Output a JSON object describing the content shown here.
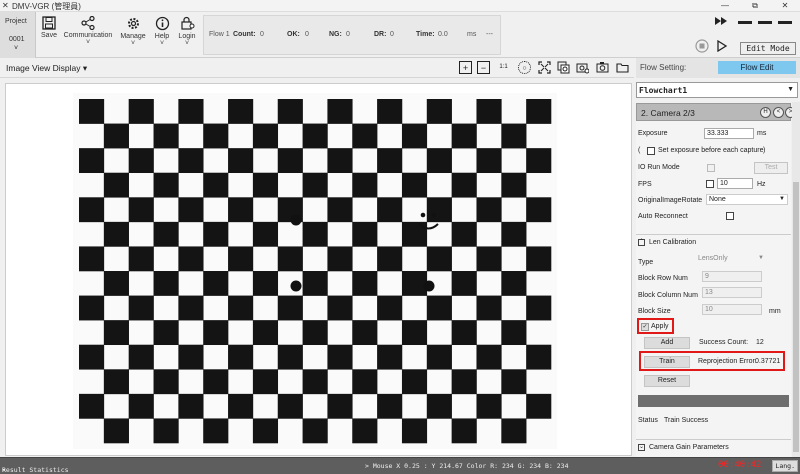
{
  "app": {
    "logo": "✕",
    "title": "DMV-VGR (管理員)",
    "min": "—",
    "restore": "⧉",
    "close": "✕"
  },
  "toolbar": {
    "project_label": "Project",
    "project_value": "0001",
    "save": "Save",
    "communication": "Communication",
    "manage": "Manage",
    "help": "Help",
    "login": "Login",
    "chevron": "˅"
  },
  "stats": {
    "flow": "Flow 1",
    "count_label": "Count:",
    "count_value": "0",
    "ok_label": "OK:",
    "ok_value": "0",
    "ng_label": "NG:",
    "ng_value": "0",
    "dr_label": "DR:",
    "dr_value": "0",
    "time_label": "Time:",
    "time_value": "0.0",
    "time_unit": "ms",
    "dash": "---"
  },
  "controls": {
    "edit_mode": "Edit Mode"
  },
  "image_view": {
    "title": "Image View Display",
    "zoom_in": "+",
    "zoom_out": "−",
    "ratio": "1:1",
    "icons": [
      "zoom-in-icon",
      "zoom-out-icon",
      "ratio-icon",
      "fit-icon",
      "fullscreen-icon",
      "layers-icon",
      "camera-settings-icon",
      "snapshot-icon",
      "folder-icon"
    ]
  },
  "board": {
    "rows": 14,
    "cols": 19,
    "color_dark": "#141414",
    "color_light": "#f7f7f7"
  },
  "right_panel": {
    "flow_setting_label": "Flow Setting:",
    "flow_edit": "Flow Edit",
    "flowchart": "Flowchart1",
    "camera_header": "2. Camera 2/3",
    "exposure_label": "Exposure",
    "exposure_value": "33.333",
    "exposure_unit": "ms",
    "paren_open": "(",
    "paren_close": ")",
    "set_exposure_label": "Set exposure before each capture",
    "io_run_label": "IO Run Mode",
    "test_btn": "Test",
    "fps_label": "FPS",
    "fps_value": "10",
    "fps_unit": "Hz",
    "rotate_label": "OriginalImageRotate",
    "rotate_value": "None",
    "auto_reconnect_label": "Auto Reconnect",
    "len_cal_header": "Len Calibration",
    "type_label": "Type",
    "type_value": "LensOnly",
    "block_row_label": "Block Row Num",
    "block_row_value": "9",
    "block_col_label": "Block Column Num",
    "block_col_value": "13",
    "block_size_label": "Block Size",
    "block_size_value": "10",
    "block_size_unit": "mm",
    "apply_label": "Apply",
    "apply_checked": true,
    "add_btn": "Add",
    "success_label": "Success Count:",
    "success_value": "12",
    "train_btn": "Train",
    "reprojection_label": "Reprojection Error:",
    "reprojection_value": "0.37721",
    "reset_btn": "Reset",
    "status_label": "Status",
    "status_value": "Train Success",
    "gain_header": "Camera Gain Parameters"
  },
  "statusbar": {
    "result_stats": "Result Statistics",
    "mouse_text": "> Mouse X 0.25 : Y 214.67 Color  R: 234 G: 234 B: 234",
    "clock": "00:40:42",
    "lang": "Lang."
  }
}
